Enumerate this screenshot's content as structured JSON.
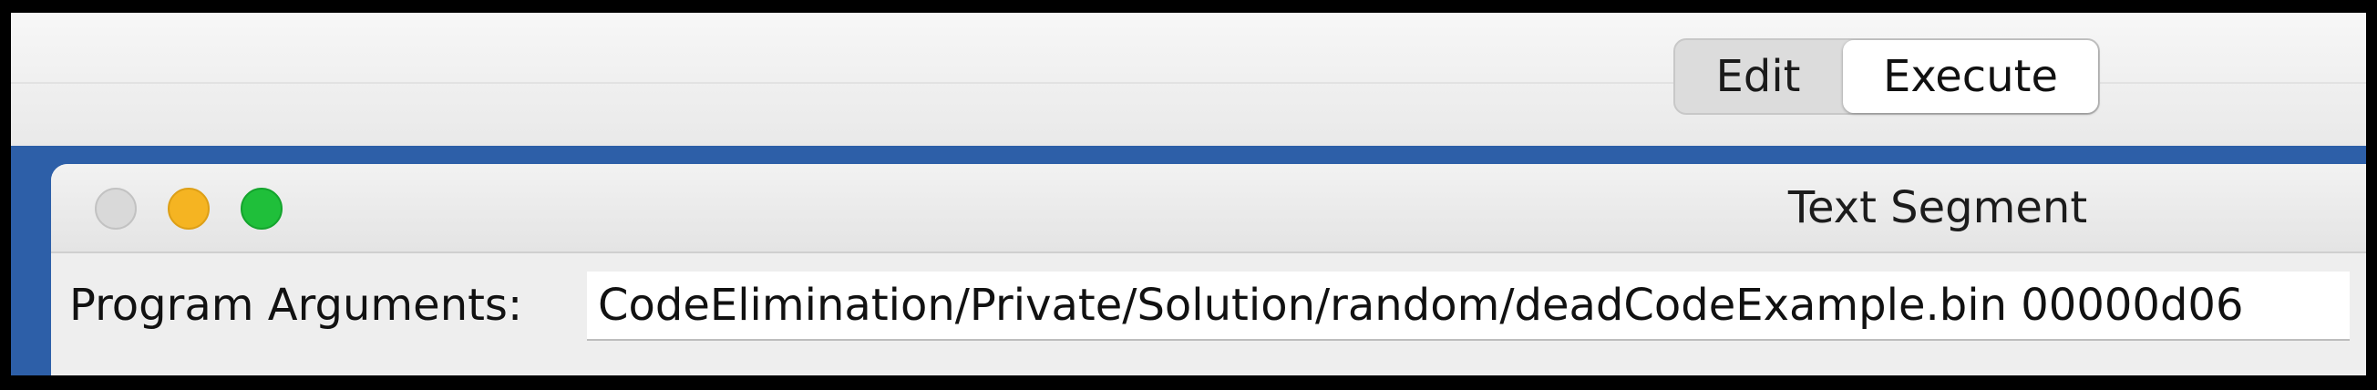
{
  "toolbar": {
    "mode_buttons": [
      {
        "label": "Edit",
        "selected": false
      },
      {
        "label": "Execute",
        "selected": true
      }
    ]
  },
  "window": {
    "title": "Text Segment",
    "traffic_lights": {
      "close_color": "#d9d9d9",
      "minimize_color": "#f5b422",
      "maximize_color": "#1fbf3a"
    }
  },
  "program_arguments": {
    "label": "Program Arguments:",
    "value": "CodeElimination/Private/Solution/random/deadCodeExample.bin 00000d06"
  },
  "colors": {
    "desktop_blue": "#2d5fa8"
  }
}
